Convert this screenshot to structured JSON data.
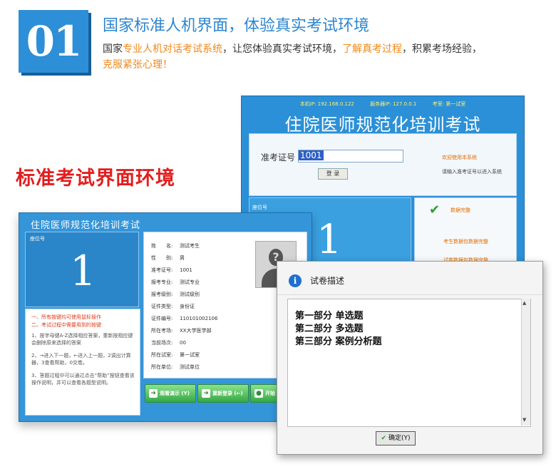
{
  "header": {
    "number": "01",
    "title": "国家标准人机界面，体验真实考试环境",
    "desc_parts": [
      "国家",
      "专业人机对话考试系统",
      "，让您体验真实考试环境，",
      "了解真考过程",
      "，积累考场经验，",
      "克服紧张心理！"
    ]
  },
  "side_heading": "标准考试界面环境",
  "login_window": {
    "local_ip": "本机IP: 192.168.0.122",
    "server_ip": "服务器IP: 127.0.0.1",
    "room": "考室: 第一试室",
    "title": "住院医师规范化培训考试",
    "exam_no_label": "准考证号",
    "exam_no_value": "1001",
    "login_button": "登 录",
    "welcome": "欢迎使用本系统",
    "hint": "请输入准考证号以进入系统",
    "seat_label": "座位号",
    "seat_number": "1",
    "data_complete": "数据完整",
    "check1": "考生数据包数据完整",
    "check2": "试卷数据包数据完整"
  },
  "exam_window": {
    "title": "住院医师规范化培训考试",
    "seat_label": "座位号",
    "seat_number": "1",
    "tips": {
      "t1": "一、所有按键均可使用鼠标操作\n二、考试过程中需要用到的按键",
      "t2": "1、按字母键A-Z选择相应答案，重新按相应键会删除原来选择的答案",
      "t3": "2、→进入下一题，←进入上一题，2调出计算器，3查看帮助，0交卷。",
      "t4": "3、答题过程中可以通过点击“帮助”按钮查看该操作说明，并可以查看各题型说明。"
    },
    "info": [
      {
        "k": "姓　　名:",
        "v": "测试考生"
      },
      {
        "k": "性　　别:",
        "v": "男"
      },
      {
        "k": "准考证号:",
        "v": "1001"
      },
      {
        "k": "报考专业:",
        "v": "测试专业"
      },
      {
        "k": "报考级别:",
        "v": "测试级别"
      },
      {
        "k": "证件类型:",
        "v": "身份证"
      },
      {
        "k": "证件编号:",
        "v": "110101002106"
      },
      {
        "k": "所在考场:",
        "v": "XX大学医学部"
      },
      {
        "k": "当前场次:",
        "v": "00"
      },
      {
        "k": "所在试室:",
        "v": "第一试室"
      },
      {
        "k": "所在单位:",
        "v": "测试单位"
      }
    ],
    "buttons": {
      "demo": "观看演示 (Y)",
      "relogin": "重新登录 (←)",
      "start": "开始"
    }
  },
  "dialog": {
    "title": "试卷描述",
    "lines": [
      "第一部分  单选题",
      "第二部分  多选题",
      "第三部分  案例分析题"
    ],
    "ok_label": "确定(Y)"
  }
}
